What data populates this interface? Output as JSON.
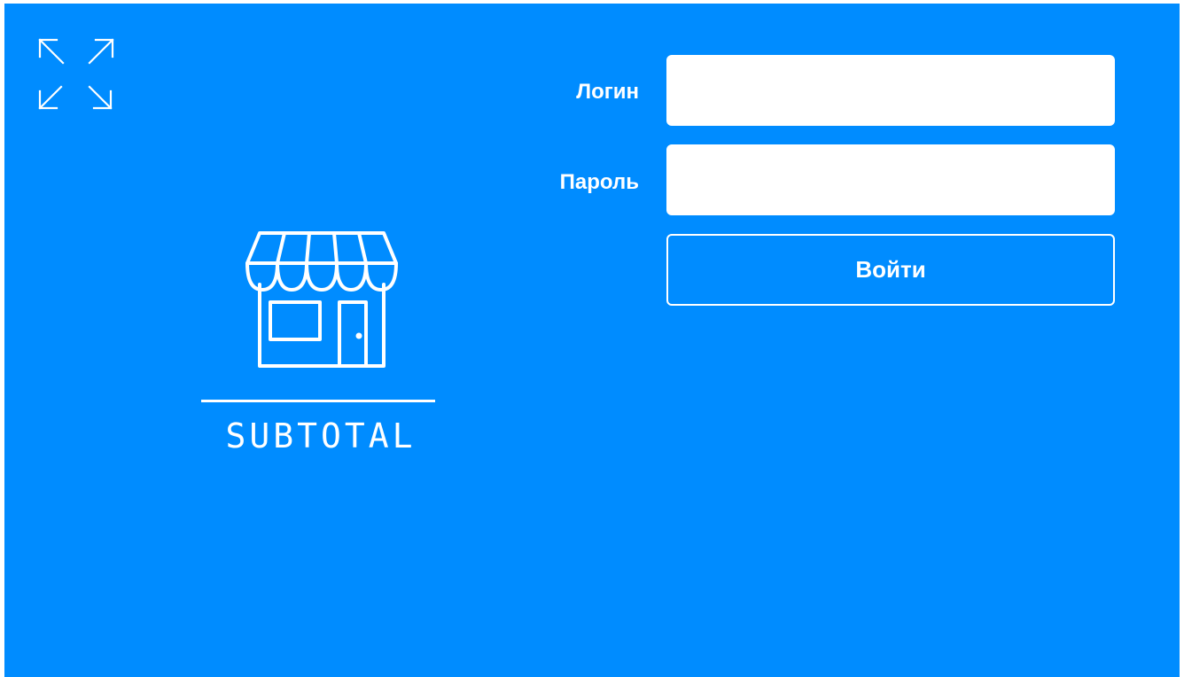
{
  "theme": {
    "background": "#008cff",
    "foreground": "#ffffff"
  },
  "toolbar": {
    "fullscreen_icon": "expand-arrows-icon"
  },
  "logo": {
    "icon": "store-icon",
    "text": "SUBTOTAL"
  },
  "form": {
    "login_label": "Логин",
    "login_value": "",
    "password_label": "Пароль",
    "password_value": "",
    "submit_label": "Войти"
  }
}
